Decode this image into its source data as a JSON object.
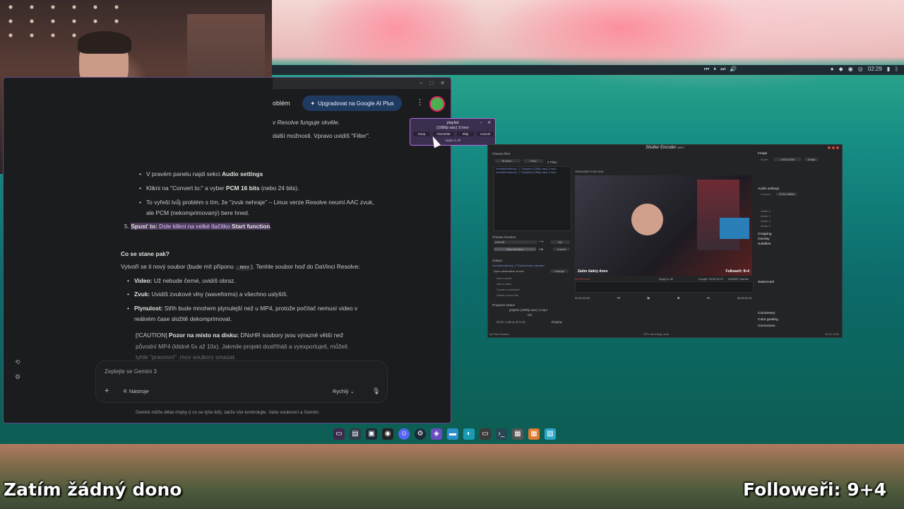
{
  "overlay": {
    "donation_text": "Zatím žádný dono",
    "followers_text": "Followeři: 9+4"
  },
  "top_bar": {
    "media_prev": "⏮",
    "media_pause": "⏸",
    "media_next": "⏭",
    "volume": "🔊",
    "clock": "02:29"
  },
  "gemini": {
    "header_title": "oblém",
    "upgrade_label": "Upgradovat na Google AI Plus",
    "lines": {
      "l1": "v Resolve funguje skvěle.",
      "l2": "další možnosti. Vpravo uvidíš \"Filter\".",
      "l3a": "V pravém panelu najdi sekci ",
      "l3b": "Audio settings",
      "l4a": "Klikni na \"Convert to:\" a vyber ",
      "l4b": "PCM 16 bits",
      "l4c": " (nebo 24 bits).",
      "l5": "To vyřeší tvůj problém s tím, že \"zvuk nehraje\" – Linux verze Resolve neumí AAC zvuk,",
      "l6": "ale PCM (nekomprimovaný) bere hned.",
      "l7num": "5.",
      "l7a": "Spusť to:",
      "l7b": " Dole klikni na velké tlačítko ",
      "l7c": "Start function",
      "l7d": ".",
      "h1": "Co se stane pak?",
      "p1a": "Vytvoří se ti nový soubor (bude mít příponu ",
      "p1code": ".mov",
      "p1b": "). Tenhle soubor hoď do DaVinci Resolve:",
      "b1a": "Video:",
      "b1b": " Už nebude černé, uvidíš obraz.",
      "b2a": "Zvuk:",
      "b2b": " Uvidíš zvukové vlny (waveforms) a všechno uslyšíš.",
      "b3a": "Plynulost:",
      "b3b": " Střih bude mnohem plynulejší než u MP4, protože počítač nemusí video v",
      "b3c": "reálném čase složitě dekomprimovat.",
      "c1a": "[!CAUTION] ",
      "c1b": "Pozor na místo na disku:",
      "c1c": " DNxHR soubory jsou výrazně větší než",
      "c2": "původní MP4 (klidně 5x až 10x). Jakmile projekt dostříháš a vyexportuješ, můžeš",
      "c3": "tyhle \"pracovní\" .mov soubory smazat."
    },
    "input_placeholder": "Zeptejte se Gemini 3",
    "tools_label": "Nástroje",
    "model_label": "Rychlý",
    "disclaimer": "Gemini může dělat chyby (i co se týče lidí), takže vše kontrolujte. Vaše soukromí a Gemini"
  },
  "popup": {
    "title": "playlist",
    "subtitle": "(1080p aac) 3.mov",
    "buttons": [
      "Keep",
      "Overwrite",
      "Skip",
      "Cancel"
    ],
    "apply_all": "Apply to all"
  },
  "shutter": {
    "title": "Shutter Encoder",
    "version": "v19.7",
    "choose_files": "Choose files",
    "browse": "Browse...",
    "clear": "Clear",
    "file_count": "2 Files",
    "files": [
      "/media/hradecky/_TT/playlist (1080p aac) 3.mp4",
      "/media/hradecky/_TT/playlist (1080p aac) 2.mp4"
    ],
    "video_info": "1920x1080 H.264 8-bit",
    "choose_function": "Choose function",
    "function_value": "DNxHR",
    "function_out": "HQ",
    "start_function": "Start function",
    "cancel": "Cancel",
    "output_label": "Output",
    "output_path": "/media/hradecky/_TT/obs/stream zaznam",
    "open_dest": "Open destination at end",
    "change": "Change",
    "option_rows": [
      "Add a prefix:",
      "Add a suffix:",
      "Create a subfolder:",
      "Delete source file"
    ],
    "progress_status": "Progress status",
    "progress_file": "playlist (1080p aac) 3.mp4",
    "progress_count": "0/4",
    "work_cutting": "Work cutting directly",
    "display": "Display",
    "apply_to_all": "Apply to all",
    "video_overlay_left": "Zatím žádný dono",
    "video_overlay_right": "Followeři: 9+4",
    "tc_start": "00:00:00:00",
    "tc_end": "00:59:51:01",
    "length": "Length: 00:59:51:07",
    "size": "4593057 frames",
    "right_sections": [
      "Image",
      "Audio settings",
      "Cropping",
      "Overlay",
      "Subtitles",
      "Watermark",
      "Colorimetry",
      "Color grading",
      "Corrections"
    ],
    "scale": "Scale:",
    "scale_value": "1920x1080",
    "adapt": "Adapt",
    "convert_label": "Convert:",
    "convert_value": "PCM 16Bits",
    "audio_rows": [
      "Audio 1:",
      "Audio 2:",
      "Audio 3:",
      "Audio 4:"
    ],
    "footer_left": "by Paul Pacifico",
    "footer_mid": "GPU decoding: auto",
    "footer_right": "26.01.2026"
  },
  "dock_icons": [
    "terminal-icon",
    "files-icon",
    "screenshot-icon",
    "obs-icon",
    "discord-icon",
    "steam-icon",
    "shield-icon",
    "folder-icon",
    "app-icon",
    "media-icon",
    "code-icon",
    "video-icon",
    "grid-icon",
    "store-icon"
  ]
}
